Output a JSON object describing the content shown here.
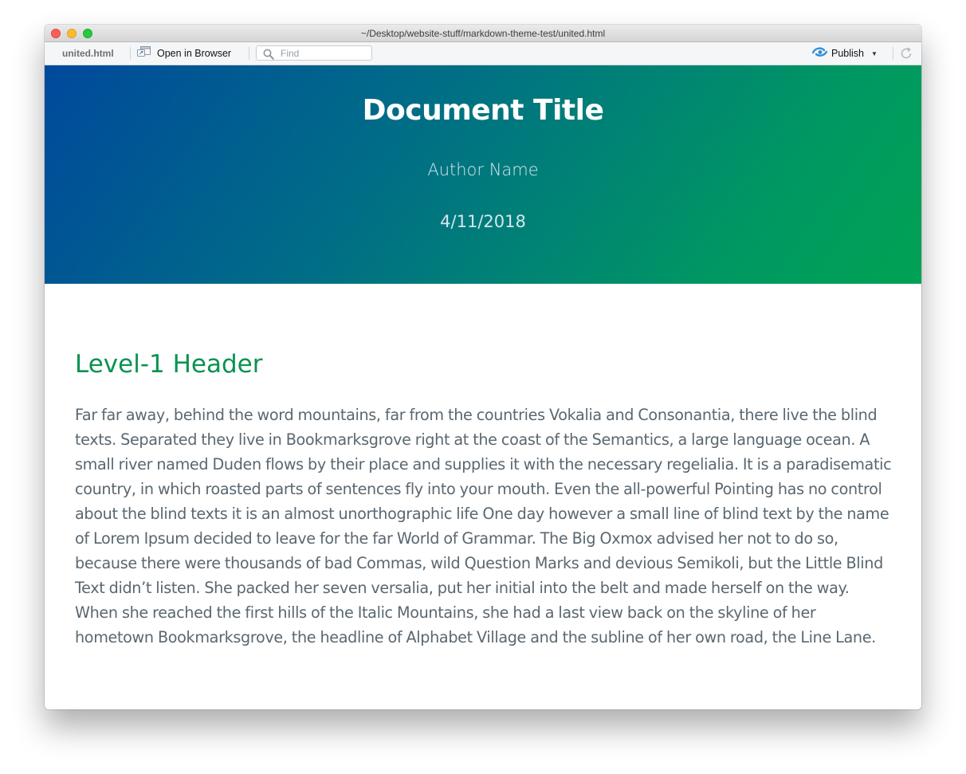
{
  "window": {
    "title": "~/Desktop/website-stuff/markdown-theme-test/united.html"
  },
  "toolbar": {
    "filename": "united.html",
    "open_in_browser_label": "Open in Browser",
    "find_placeholder": "Find",
    "publish_label": "Publish"
  },
  "icons": {
    "open_in_browser": "open-in-browser-icon",
    "find": "search-icon",
    "publish": "publish-icon",
    "publish_menu": "caret-down-icon",
    "refresh": "refresh-icon"
  },
  "document": {
    "title": "Document Title",
    "author": "Author Name",
    "date": "4/11/2018",
    "header_colors": [
      "#00499c",
      "#009862"
    ],
    "heading_color": "#0a9350",
    "text_color": "#5a6770"
  },
  "content": {
    "h1": "Level-1 Header",
    "paragraph": "Far far away, behind the word mountains, far from the countries Vokalia and Consonantia, there live the blind texts. Separated they live in Bookmarksgrove right at the coast of the Semantics, a large language ocean. A small river named Duden flows by their place and supplies it with the necessary regelialia. It is a paradisematic country, in which roasted parts of sentences fly into your mouth. Even the all-powerful Pointing has no control about the blind texts it is an almost unorthographic life One day however a small line of blind text by the name of Lorem Ipsum decided to leave for the far World of Grammar. The Big Oxmox advised her not to do so, because there were thousands of bad Commas, wild Question Marks and devious Semikoli, but the Little Blind Text didn’t listen. She packed her seven versalia, put her initial into the belt and made herself on the way. When she reached the first hills of the Italic Mountains, she had a last view back on the skyline of her hometown Bookmarksgrove, the headline of Alphabet Village and the subline of her own road, the Line Lane."
  }
}
